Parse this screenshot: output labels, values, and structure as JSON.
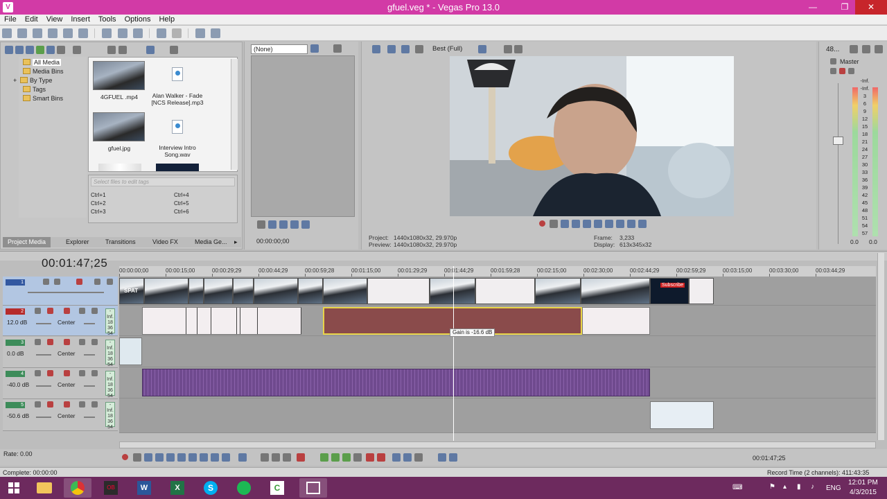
{
  "window": {
    "title": "gfuel.veg * - Vegas Pro 13.0",
    "minimize": "—",
    "maximize": "❐",
    "close": "✕"
  },
  "menu": [
    "File",
    "Edit",
    "View",
    "Insert",
    "Tools",
    "Options",
    "Help"
  ],
  "explorer": {
    "tree": [
      "All Media",
      "Media Bins",
      "By Type",
      "Tags",
      "Smart Bins"
    ],
    "media": [
      {
        "name": "4GFUEL .mp4",
        "kind": "video"
      },
      {
        "name": "Alan Walker - Fade [NCS Release].mp3",
        "kind": "audio"
      },
      {
        "name": "gfuel.jpg",
        "kind": "image"
      },
      {
        "name": "Interview Intro Song.wav",
        "kind": "audio"
      }
    ],
    "tag_placeholder": "Select files to edit tags",
    "shortcuts": [
      "Ctrl+1",
      "Ctrl+4",
      "Ctrl+2",
      "Ctrl+5",
      "Ctrl+3",
      "Ctrl+6"
    ],
    "tabs": [
      "Project Media",
      "Explorer",
      "Transitions",
      "Video FX",
      "Media Ge..."
    ]
  },
  "trimmer": {
    "select_value": "(None)",
    "timecode": "00:00:00;00"
  },
  "preview": {
    "quality": "Best (Full)",
    "project_label": "Project:",
    "project_value": "1440x1080x32, 29.970p",
    "preview_label": "Preview:",
    "preview_value": "1440x1080x32, 29.970p",
    "frame_label": "Frame:",
    "frame_value": "3,233",
    "display_label": "Display:",
    "display_value": "613x345x32"
  },
  "master": {
    "title": "Master",
    "zoom": "48...",
    "scale": [
      "-Inf.",
      "-Inf.",
      "3",
      "6",
      "9",
      "12",
      "15",
      "18",
      "21",
      "24",
      "27",
      "30",
      "33",
      "36",
      "39",
      "42",
      "45",
      "48",
      "51",
      "54",
      "57"
    ],
    "left_value": "0.0",
    "right_value": "0.0"
  },
  "timeline": {
    "timecode": "00:01:47;25",
    "ruler": [
      "00:00:00;00",
      "00:00:15;00",
      "00:00:29;29",
      "00:00:44;29",
      "00:00:59;28",
      "00:01:15;00",
      "00:01:29;29",
      "00:01:44;29",
      "00:01:59;28",
      "00:02:15;00",
      "00:02:30;00",
      "00:02:44;29",
      "00:02:59;29",
      "00:03:15;00",
      "00:03:30;00",
      "00:03:44;29"
    ],
    "tracks": [
      {
        "num": "1",
        "type": "video"
      },
      {
        "num": "2",
        "type": "audio",
        "volume": "12.0 dB",
        "pan": "Center"
      },
      {
        "num": "3",
        "type": "audio",
        "volume": "0.0 dB",
        "pan": "Center"
      },
      {
        "num": "4",
        "type": "audio",
        "volume": "-40.0 dB",
        "pan": "Center"
      },
      {
        "num": "5",
        "type": "audio",
        "volume": "-50.6 dB",
        "pan": "Center"
      }
    ],
    "meter_labels": [
      "-Inf.",
      "18",
      "36",
      "54"
    ],
    "tooltip": "Gain is -16.6 dB",
    "subscribe_text": "Subscribe",
    "clip_label": "SPAT"
  },
  "transport": {
    "rate": "Rate: 0.00",
    "timecode": "00:01:47;25"
  },
  "status": {
    "left": "Complete: 00:00:00",
    "right": "Record Time (2 channels): 411:43:35"
  },
  "taskbar": {
    "lang": "ENG",
    "time": "12:01 PM",
    "date": "4/3/2015"
  }
}
